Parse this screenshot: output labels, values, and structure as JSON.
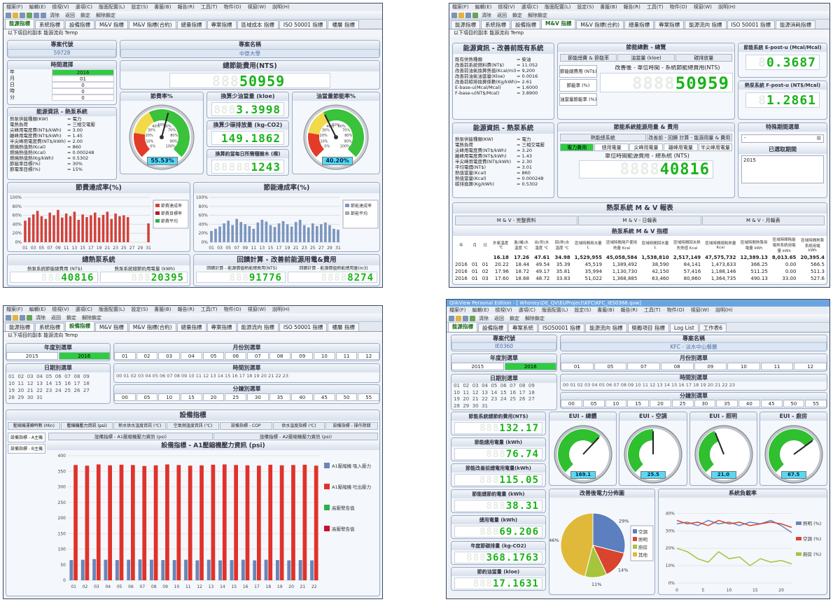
{
  "app": {
    "menu": [
      "檔案(F)",
      "編輯(E)",
      "檢視(V)",
      "選項(C)",
      "版面配置(L)",
      "設定(S)",
      "書籤(B)",
      "報告(R)",
      "工具(T)",
      "物件(O)",
      "視窗(W)",
      "說明(H)"
    ],
    "toolbar": {
      "clear_label": "清除",
      "back_label": "返回",
      "lock_label": "鎖定",
      "unlock_label": "解除鎖定"
    }
  },
  "q1": {
    "tabs": [
      "能源指標",
      "系統指標",
      "設備指標",
      "M&V 指標",
      "M&V 指標(合約)",
      "總量指標",
      "專案指標",
      "區域成本 指標",
      "ISO 50001 指標",
      "樓層 指標"
    ],
    "active_tab": "能源指標",
    "subbar": "以下項目的副本 能源流向 Temp",
    "project_code_label": "專案代號",
    "project_code": "59728",
    "project_name_label": "專案名稱",
    "project_name": "中原大學",
    "time_select_title": "時間選擇",
    "time_rows": [
      {
        "k": "年",
        "v": "2016"
      },
      {
        "k": "月",
        "v": "01"
      },
      {
        "k": "日",
        "v": "0"
      },
      {
        "k": "時",
        "v": "0"
      },
      {
        "k": "分",
        "v": "0"
      }
    ],
    "total_cost_title": "總節能費用(NTS)",
    "total_cost_digits": "50959",
    "saving_rate_title": "節費率%",
    "saving_rate_value": "55.53%",
    "saving_rate": 55.53,
    "reduce_oil_title": "換算少油當量 (kloe)",
    "reduce_oil": "3.3998",
    "reduce_co2_title": "換算少碳排放量 (kg-CO2)",
    "reduce_co2": "149.1862",
    "trees_title": "換算約當每日所需種樹木 (棵)",
    "trees": "1243",
    "oil_rate_title": "油當量節能率%",
    "oil_rate_value": "40.20%",
    "oil_rate": 40.2,
    "energy_info_title": "能源資訊 - 熱泵系統",
    "energy_info": [
      [
        "熱泵供能種類(KW)",
        "= 電力"
      ],
      [
        "電熱負荷",
        "= 三相交電壓"
      ],
      [
        "尖峰用電度費(NT$/kWh)",
        "= 3.00"
      ],
      [
        "離峰用電度費(NT$/kWh)",
        "= 1.45"
      ],
      [
        "半尖峰用電度費(NT$/kWh)",
        "= 2.00"
      ],
      [
        "燃燒熱值熱(Kcal)",
        "= 860"
      ],
      [
        "燃燒熱值熱(Kcal)",
        "= 0.000248"
      ],
      [
        "燃燒熱值熱(Kg/kWh)",
        "= 0.5302"
      ],
      [
        "節能率目標(%)",
        "= 30%"
      ],
      [
        "節電率目標(%)",
        "= 15%"
      ]
    ],
    "chart_left_title": "節費達成率(%)",
    "chart_right_title": "節能達成率(%)",
    "bottom_title": "總熱泵系統",
    "bottom_cost_title": "熱泵系統節能總費用 (NT$)",
    "bottom_cost": "40816",
    "bottom_kwh_title": "熱泵系統總節約用電量 (kWh)",
    "bottom_kwh": "20395",
    "recov_title": "回饋計算 - 改善前能源用電&費用",
    "recov_a_title": "回饋計算 - 能源價值熱能總費用(NTS)",
    "recov_a": "91776",
    "recov_b_title": "回饋計算 - 能源價值熱能總用量(m3)",
    "recov_b": "8274",
    "left_legend": [
      "節費達成率",
      "節費目標率",
      "節費平均"
    ],
    "right_legend": [
      "節能達成率",
      "節能平均"
    ],
    "days_label": "日"
  },
  "q2": {
    "tabs": [
      "能源指標",
      "系統指標",
      "設備指標",
      "M&V 指標",
      "M&V 指標(合約)",
      "總量指標",
      "專案指標",
      "能源流向 指標",
      "ISO 50001 指標",
      "能源消耗指標"
    ],
    "active_tab": "M&V 指標",
    "subbar": "以下項目的副本 能源流向 Temp",
    "info_title": "能源資訊 - 改善前既有系統",
    "info": [
      [
        "既有供熱種類",
        "= 柴油"
      ],
      [
        "改善前系統燃料費(NT$)",
        "= 11.052"
      ],
      [
        "改善前油氣換算熱值(Kcal/m3)",
        "= 9,200"
      ],
      [
        "改善前油氣油當量(Kloe)",
        "= 0.0016"
      ],
      [
        "改善前碳排換算係數(Kg/kWh)",
        "= 2.61"
      ],
      [
        "E-base-u(Mcal/Mcal)",
        "= 1.6000"
      ],
      [
        "F-base-u(NT$/Mcal)",
        "= 3.8900"
      ]
    ],
    "saving_title": "節能總數 - 總覽",
    "saving_btns": [
      "節能總費 & 節能率",
      "油當量 (kloe)",
      "碳排放量"
    ],
    "saving_rows": [
      "節能總費用 (NT$)",
      "節能率 (%)",
      "油當量節能率 (%)"
    ],
    "saving_desc": "改善後 - 單位時間 - 系統節能總費用(NTS)",
    "saving_digits": "50959",
    "epost_title": "節能系統 E-post-u (Mcal/Mcal)",
    "epost": "0.3687",
    "fpost_title": "熱泵系統 F-post-u (NT$/Mcal)",
    "fpost": "1.2861",
    "info2_title": "能源資訊 - 熱泵系統",
    "info2": [
      [
        "熱泵供能種類(KW)",
        "= 電力"
      ],
      [
        "電熱負荷",
        "= 三相交電壓"
      ],
      [
        "尖峰用電度費(NT$/kWh)",
        "= 3.20"
      ],
      [
        "離峰用電度費(NT$/kWh)",
        "= 1.43"
      ],
      [
        "半尖峰用電度費(NT$/kWh)",
        "= 2.30"
      ],
      [
        "平均電價(NT$)",
        "= 3.01"
      ],
      [
        "熱值當量(Kcal)",
        "= 860"
      ],
      [
        "熱值當量(Kcal)",
        "= 0.000248"
      ],
      [
        "碳排換算(Kg/kWh)",
        "= 0.5302"
      ]
    ],
    "power_title": "節能系統能源用量 & 費用",
    "power_btns1": [
      "熱能總系統",
      "改善前 - 回饋 計算 - 能源用量 & 費用"
    ],
    "power_btns2": [
      "電力費用",
      "總用電量",
      "尖峰用電量",
      "離峰用電量",
      "半尖峰用電量"
    ],
    "power_desc": "單位時間能源費用 - 總系統 (NTS)",
    "power_digits": "40816",
    "period_title": "特殊期間選單",
    "period_select": "-",
    "period_sub_title": "已選取期間",
    "period_sub": "2015",
    "mv_title": "熱泵系統 M & V 報表",
    "mv_tabs": [
      "M & V - 完整資料",
      "M & V - 日報表",
      "M & V - 月報表"
    ],
    "mv_table_title": "熱泵系統 M & V 指標",
    "mv_headers": [
      "年",
      "月",
      "日",
      "外氣溫度 ℃",
      "進(補)水溫度 ℃",
      "出(供)水溫度 ℃",
      "回(熱)水溫度 ℃",
      "區域時間用水量 L",
      "區域時間用戶使用熱量 Kcal",
      "區域時間回水量 L",
      "區域時間回水熱失熱值 Kcal",
      "區域時間總耗熱量 Kcal",
      "區域時間熱泵用電量 kWh",
      "區域時間耗能電熱系統用電量 kWh",
      "區域時間熱泵系統用電 kWh"
    ],
    "mv_sum": [
      "",
      "",
      "",
      "16.18",
      "17.26",
      "47.61",
      "34.98",
      "1,529,955",
      "45,058,584",
      "1,538,810",
      "2,517,149",
      "47,575,732",
      "12,389.13",
      "8,013.65",
      "20,395.4"
    ],
    "mv_rows": [
      [
        "2016",
        "01",
        "01",
        "20.22",
        "18.44",
        "49.54",
        "35.39",
        "45,519",
        "1,389,492",
        "38,590",
        "84,141",
        "1,473,633",
        "366.25",
        "0.00",
        "566.5"
      ],
      [
        "2016",
        "01",
        "02",
        "17.96",
        "18.72",
        "49.17",
        "35.81",
        "35,994",
        "1,130,730",
        "42,150",
        "57,416",
        "1,188,146",
        "511.25",
        "0.00",
        "511.3"
      ],
      [
        "2016",
        "01",
        "03",
        "17.60",
        "18.68",
        "48.72",
        "33.83",
        "51,022",
        "1,368,885",
        "63,460",
        "80,860",
        "1,364,735",
        "490.13",
        "33.00",
        "527.6"
      ]
    ]
  },
  "q3": {
    "tabs": [
      "能源指標",
      "系統指標",
      "設備指標",
      "M&V 指標",
      "M&V 指標(合約)",
      "總量指標",
      "專案指標",
      "能源流向 指標",
      "ISO 50001 指標",
      "樓層 指標"
    ],
    "active_tab": "設備指標",
    "subbar": "以下項目的副本 能源流向 Temp",
    "year_title": "年度別選單",
    "years": [
      "2015",
      "2016"
    ],
    "active_year": "2016",
    "month_title": "月份別選單",
    "months": [
      "01",
      "02",
      "03",
      "04",
      "05",
      "06",
      "07",
      "08",
      "09",
      "10",
      "11",
      "12"
    ],
    "day_title": "日期別選單",
    "hour_title": "時間別選單",
    "minute_title": "分鐘別選單",
    "minutes": [
      "00",
      "05",
      "10",
      "15",
      "20",
      "25",
      "30",
      "35",
      "40",
      "45",
      "50",
      "55"
    ],
    "device_title": "設備指標",
    "device_tabs": [
      "壓縮機運轉時數 (Min)",
      "壓縮機壓力資訊 (psi)",
      "熱水供水溫度資訊 (℃)",
      "空氣側溫度資訊 (℃)",
      "設備指標 - COP",
      "供水溫度指標 (℃)",
      "設備指標 - 操作除錯"
    ],
    "side_items": [
      "設備指標 - A主機",
      "設備指標 - B主機"
    ],
    "sub_tabs": [
      "設備指標 - A1壓縮機壓力資訊 (psi)",
      "設備指標 - A2壓縮機壓力資訊 (psi)"
    ],
    "chart_title": "設備指標 - A1壓縮機壓力資訊 (psi)",
    "legend": [
      "A1壓縮機 吸入壓力",
      "A1壓縮機 吐出壓力",
      "高壓警告值",
      "高壓警告值"
    ],
    "days_label": "日"
  },
  "q4": {
    "window_title": "QlikView Personal Edition - [ Whoney\\DE_QV\\EUProject\\KFC\\KFC_IES0368.qvw]",
    "tabs": [
      "能源指標",
      "設備指標",
      "專案系統",
      "ISO50001 指標",
      "能源流向 指標",
      "獎勵項目 指標",
      "Log List",
      "工作表6"
    ],
    "active_tab": "能源指標",
    "project_code_label": "專案代號",
    "project_code": "IE0360",
    "project_name_label": "專案名稱",
    "project_name": "KFC - 淡水中山餐廳",
    "year_title": "年度別選單",
    "years": [
      "2015",
      "2016"
    ],
    "active_year": "2016",
    "month_title": "月份別選單",
    "months": [
      "01",
      "05",
      "07",
      "08",
      "09",
      "10",
      "11",
      "12"
    ],
    "day_title": "日期別選單",
    "hour_title": "時間別選單",
    "minute_title": "分鐘別選單",
    "minutes": [
      "00",
      "05",
      "10",
      "15",
      "20",
      "25",
      "30",
      "35",
      "40",
      "45",
      "50",
      "55"
    ],
    "metrics": [
      {
        "title": "節能系統總節約費用(NT$)",
        "value": "132.17"
      },
      {
        "title": "節能總用電量 (kWh)",
        "value": "76.74"
      },
      {
        "title": "節能改善前總電用電量(kWh)",
        "value": "115.05"
      },
      {
        "title": "節能總節約電量 (kWh)",
        "value": "38.31"
      },
      {
        "title": "總用電量 (kWh)",
        "value": "69.206"
      },
      {
        "title": "年度節碳排量 (kg-CO2)",
        "value": "368.1763"
      },
      {
        "title": "節約油當量 (kloe)",
        "value": "17.1631"
      }
    ],
    "gauges": [
      {
        "title": "EUI - 總體",
        "value": "169.1",
        "pct": 0.66
      },
      {
        "title": "EUI - 空調",
        "value": "25.5",
        "pct": 0.5
      },
      {
        "title": "EUI - 照明",
        "value": "21.0",
        "pct": 0.42
      },
      {
        "title": "EUI - 廚房",
        "value": "67.5",
        "pct": 0.7
      }
    ],
    "pie_title": "改善後電力分佈圖",
    "pie_labels": [
      "空調",
      "照明",
      "廚房",
      "其他"
    ],
    "pie_pct": [
      "29%",
      "14%",
      "11%",
      "46%"
    ],
    "load_title": "系統負載率",
    "load_legend": [
      "照明 (%)",
      "空調 (%)",
      "廚房 (%)"
    ],
    "days_label": "日"
  },
  "chart_data": [
    {
      "type": "bar",
      "title": "節費達成率(%)",
      "categories": [
        "01",
        "02",
        "03",
        "04",
        "05",
        "06",
        "07",
        "08",
        "09",
        "10",
        "11",
        "12",
        "13",
        "14",
        "15",
        "16",
        "17",
        "18",
        "19",
        "20",
        "21",
        "22",
        "23",
        "24",
        "25",
        "26",
        "27",
        "28",
        "29",
        "30",
        "31"
      ],
      "series": [
        {
          "name": "節費達成率",
          "values": [
            48,
            55,
            62,
            70,
            58,
            52,
            66,
            60,
            72,
            55,
            64,
            58,
            68,
            50,
            62,
            56,
            60,
            66,
            55,
            61,
            68,
            52,
            64,
            58,
            60,
            56,
            0,
            0,
            0,
            0,
            42
          ]
        }
      ],
      "ylim": [
        0,
        100
      ]
    },
    {
      "type": "bar",
      "title": "節能達成率(%)",
      "categories": [
        "01",
        "02",
        "03",
        "04",
        "05",
        "06",
        "07",
        "08",
        "09",
        "10",
        "11",
        "12",
        "13",
        "14",
        "15",
        "16",
        "17",
        "18",
        "19",
        "20",
        "21",
        "22",
        "23",
        "24",
        "25",
        "26",
        "27",
        "28",
        "29",
        "30",
        "31"
      ],
      "series": [
        {
          "name": "節能達成率",
          "values": [
            25,
            30,
            35,
            42,
            48,
            38,
            52,
            45,
            40,
            36,
            30,
            44,
            50,
            46,
            38,
            34,
            42,
            47,
            40,
            35,
            45,
            50,
            38,
            33,
            42,
            36,
            40,
            44,
            38,
            30,
            28
          ]
        }
      ],
      "ylim": [
        0,
        100
      ]
    },
    {
      "type": "bar",
      "title": "設備指標 - A1壓縮機壓力資訊 (psi)",
      "categories": [
        "01",
        "02",
        "03",
        "04",
        "05",
        "06",
        "07",
        "08",
        "09",
        "10",
        "11",
        "12",
        "13",
        "14",
        "15",
        "16",
        "17",
        "18",
        "19",
        "20",
        "21",
        "22"
      ],
      "series": [
        {
          "name": "A1壓縮機 吸入壓力",
          "values": [
            65,
            66,
            68,
            66,
            65,
            66,
            67,
            66,
            65,
            65,
            66,
            64,
            66,
            64,
            65,
            66,
            64,
            66,
            65,
            64,
            65,
            64
          ]
        },
        {
          "name": "A1壓縮機 吐出壓力",
          "values": [
            370,
            368,
            372,
            369,
            371,
            370,
            367,
            369,
            372,
            370,
            368,
            369,
            371,
            372,
            370,
            369,
            368,
            371,
            369,
            370,
            371,
            368
          ]
        }
      ],
      "ylim": [
        0,
        400
      ]
    },
    {
      "type": "pie",
      "title": "改善後電力分佈圖",
      "categories": [
        "空調",
        "照明",
        "廚房",
        "其他"
      ],
      "values": [
        29,
        14,
        11,
        46
      ]
    },
    {
      "type": "line",
      "title": "系統負載率",
      "x": [
        0,
        2,
        4,
        6,
        8,
        10,
        12,
        14,
        16,
        18,
        20,
        22
      ],
      "series": [
        {
          "name": "照明 (%)",
          "values": [
            34,
            35,
            33,
            36,
            34,
            35,
            33,
            35,
            34,
            36,
            33,
            29
          ]
        },
        {
          "name": "空調 (%)",
          "values": [
            36,
            34,
            35,
            33,
            36,
            34,
            35,
            33,
            34,
            35,
            34,
            32
          ]
        },
        {
          "name": "廚房 (%)",
          "values": [
            20,
            18,
            14,
            12,
            18,
            14,
            15,
            10,
            14,
            12,
            13,
            11
          ]
        }
      ],
      "ylim": [
        0,
        45
      ]
    }
  ]
}
